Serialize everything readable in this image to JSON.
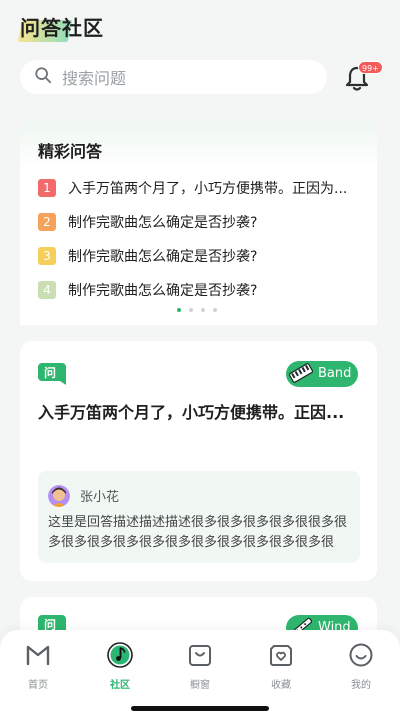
{
  "header": {
    "title": "问答社区"
  },
  "search": {
    "placeholder": "搜索问题"
  },
  "notifications": {
    "badge": "99+"
  },
  "featured": {
    "title": "精彩问答",
    "items": [
      {
        "rank": "1",
        "text": "入手万笛两个月了，小巧方便携带。正因为...",
        "color": "#f26b6b"
      },
      {
        "rank": "2",
        "text": "制作完歌曲怎么确定是否抄袭?",
        "color": "#f5a35a"
      },
      {
        "rank": "3",
        "text": "制作完歌曲怎么确定是否抄袭?",
        "color": "#f6cf5a"
      },
      {
        "rank": "4",
        "text": "制作完歌曲怎么确定是否抄袭?",
        "color": "#c9dfb3"
      }
    ],
    "pagination": {
      "total": 4,
      "active": 0
    }
  },
  "question_card": {
    "badge": "问",
    "tag": "Band",
    "tag_icon": "keyboard-icon",
    "question": "入手万笛两个月了，小巧方便携带。正因...",
    "answer": {
      "user": "张小花",
      "text": "这里是回答描述描述描述很多很多很多很多很很多很多很多很多很多很多很多很多很多很多很多很多很多..."
    }
  },
  "question_card_2": {
    "badge": "问",
    "tag": "Wind",
    "tag_icon": "flute-icon"
  },
  "tabbar": {
    "items": [
      {
        "label": "首页",
        "icon": "home-m-icon",
        "active": false
      },
      {
        "label": "社区",
        "icon": "music-note-icon",
        "active": true
      },
      {
        "label": "橱窗",
        "icon": "shopping-bag-icon",
        "active": false
      },
      {
        "label": "收藏",
        "icon": "favorite-box-icon",
        "active": false
      },
      {
        "label": "我的",
        "icon": "smile-icon",
        "active": false
      }
    ]
  },
  "colors": {
    "accent": "#2bb573",
    "tag": "#2fb66e",
    "badge": "#f45b5b"
  }
}
